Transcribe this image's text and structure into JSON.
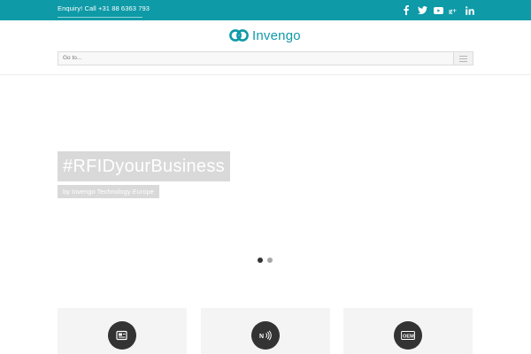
{
  "topbar": {
    "enquiry_text": "Enquiry! Call +31 88 6363 793",
    "background": "#0e9aa7",
    "social": [
      {
        "name": "facebook",
        "icon": "facebook-icon"
      },
      {
        "name": "twitter",
        "icon": "twitter-icon"
      },
      {
        "name": "youtube",
        "icon": "youtube-icon"
      },
      {
        "name": "google-plus",
        "icon": "google-plus-icon"
      },
      {
        "name": "linkedin",
        "icon": "linkedin-icon"
      }
    ]
  },
  "header": {
    "logo_text": "Invengo",
    "brand_color": "#0e9aa7",
    "nav_placeholder": "Go to..."
  },
  "hero": {
    "title": "#RFIDyourBusiness",
    "subtitle": "by Invengo Technology Europe",
    "slides_total": 2,
    "slide_active": 1
  },
  "features": [
    {
      "icon": "card-reader-icon"
    },
    {
      "icon": "nfc-icon"
    },
    {
      "icon": "oem-icon"
    }
  ]
}
